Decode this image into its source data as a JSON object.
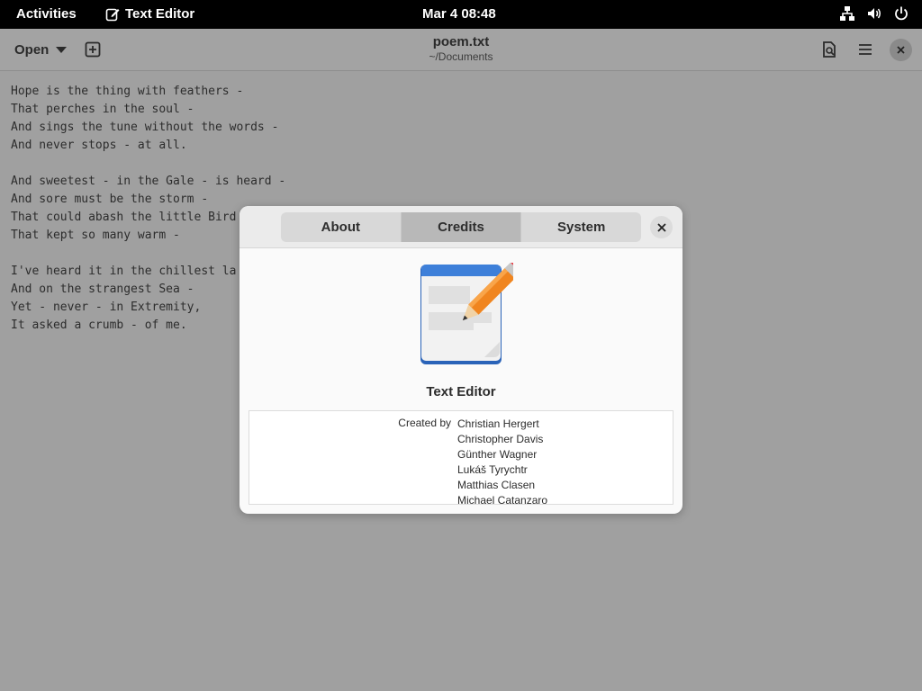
{
  "topbar": {
    "activities": "Activities",
    "app_name": "Text Editor",
    "clock": "Mar 4  08:48",
    "icons": [
      "network-icon",
      "volume-icon",
      "power-icon"
    ]
  },
  "headerbar": {
    "open_label": "Open",
    "title": "poem.txt",
    "subtitle": "~/Documents"
  },
  "editor": {
    "lines": [
      "Hope is the thing with feathers -",
      "That perches in the soul -",
      "And sings the tune without the words -",
      "And never stops - at all.",
      "",
      "And sweetest - in the Gale - is heard -",
      "And sore must be the storm -",
      "That could abash the little Bird",
      "That kept so many warm -",
      "",
      "I've heard it in the chillest la",
      "And on the strangest Sea -",
      "Yet - never - in Extremity,",
      "It asked a crumb - of me."
    ]
  },
  "dialog": {
    "tabs": [
      {
        "label": "About",
        "active": false
      },
      {
        "label": "Credits",
        "active": true
      },
      {
        "label": "System",
        "active": false
      }
    ],
    "app_name": "Text Editor",
    "credits_label": "Created by",
    "credits_names": [
      "Christian Hergert",
      "Christopher Davis",
      "Günther Wagner",
      "Lukáš Tyrychtr",
      "Matthias Clasen",
      "Michael Catanzaro"
    ]
  },
  "colors": {
    "logo_blue": "#3d7fd9",
    "pencil_orange": "#f0851f",
    "eraser_red": "#e8424a"
  }
}
